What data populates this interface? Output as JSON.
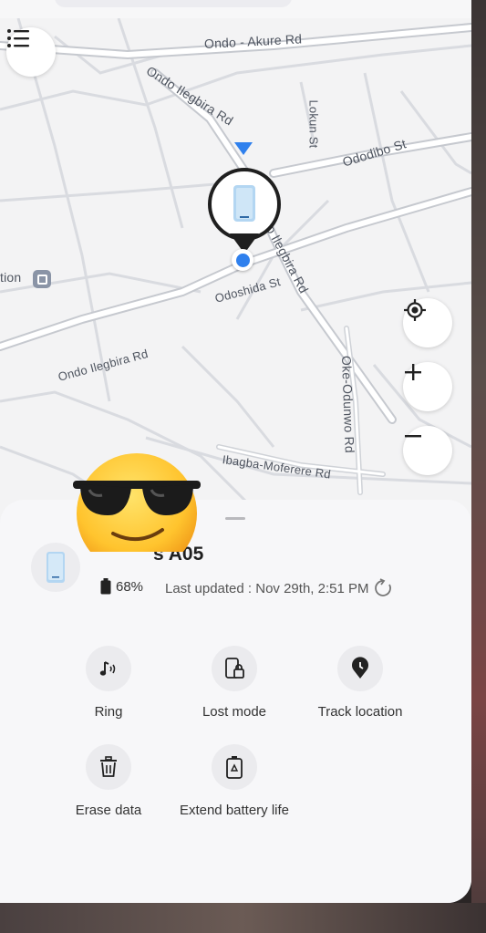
{
  "map": {
    "labels": {
      "ondo_akure": "Ondo - Akure Rd",
      "ondo_ilegbira_top": "Ondo Ilegbira Rd",
      "lokun": "Lokun St",
      "ododibo": "Ododibo St",
      "ilegbira_right": "o Ilegbira Rd",
      "station": "tion",
      "odoshida": "Odoshida St",
      "ondo_ilegbira_left": "Ondo Ilegbira Rd",
      "oke_odunwo": "Oke-Odunwo Rd",
      "ibagba": "Ibagba-Moferere Rd"
    }
  },
  "device": {
    "name": "s A05",
    "battery": "68%",
    "last_updated": "Last updated : Nov 29th, 2:51 PM"
  },
  "actions": {
    "ring": "Ring",
    "lost_mode": "Lost mode",
    "track_location": "Track location",
    "erase_data": "Erase data",
    "extend_battery": "Extend battery life"
  },
  "colors": {
    "accent": "#2f80ed",
    "pin_dark": "#1f1f1f",
    "sheet_bg": "#f7f7f9"
  },
  "icons": {
    "menu": "list-menu-icon",
    "locate": "my-location-icon",
    "zoom_in": "plus-icon",
    "zoom_out": "minus-icon",
    "refresh": "refresh-icon"
  }
}
